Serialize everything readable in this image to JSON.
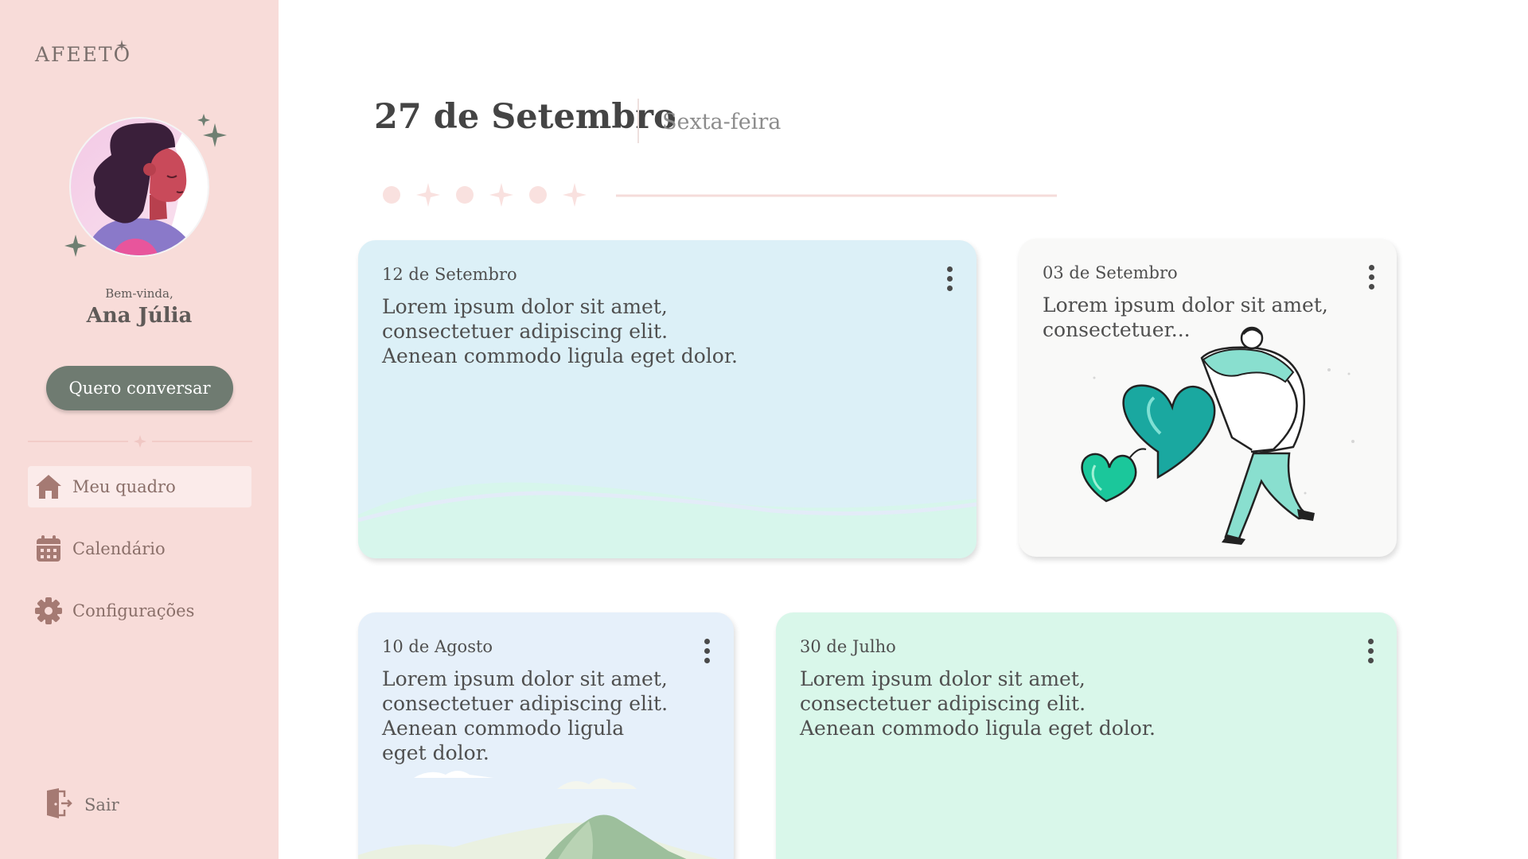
{
  "app": {
    "logo": "AFEETO"
  },
  "sidebar": {
    "greeting": "Bem-vinda,",
    "user_name": "Ana Júlia",
    "talk_button": "Quero conversar",
    "nav": [
      {
        "label": "Meu quadro",
        "icon": "home-icon",
        "active": true
      },
      {
        "label": "Calendário",
        "icon": "calendar-icon",
        "active": false
      },
      {
        "label": "Configurações",
        "icon": "gear-icon",
        "active": false
      }
    ],
    "logout": {
      "label": "Sair",
      "icon": "logout-icon"
    }
  },
  "header": {
    "date": "27 de Setembro",
    "weekday": "Sexta-feira"
  },
  "cards": [
    {
      "date": "12 de Setembro",
      "text": "Lorem ipsum dolor sit amet, consectetuer adipiscing elit. Aenean commodo ligula eget dolor.",
      "color": "#dcf0f7"
    },
    {
      "date": "03 de Setembro",
      "text": "Lorem ipsum dolor sit amet, consectetuer...",
      "color": "#f9f9f8"
    },
    {
      "date": "10 de Agosto",
      "text": "Lorem ipsum dolor sit amet, consectetuer adipiscing elit. Aenean commodo ligula eget dolor.",
      "color": "#e6f0fa"
    },
    {
      "date": "30 de Julho",
      "text": "Lorem ipsum dolor sit amet, consectetuer adipiscing elit. Aenean commodo ligula eget dolor.",
      "color": "#d9f7ea"
    }
  ],
  "colors": {
    "sidebar_bg": "#f8dcd9",
    "button_bg": "#6f7b71",
    "nav_icon": "#a57a73",
    "accent_pink": "#f6d4d1",
    "accent_teal": "#1bb3a3"
  }
}
